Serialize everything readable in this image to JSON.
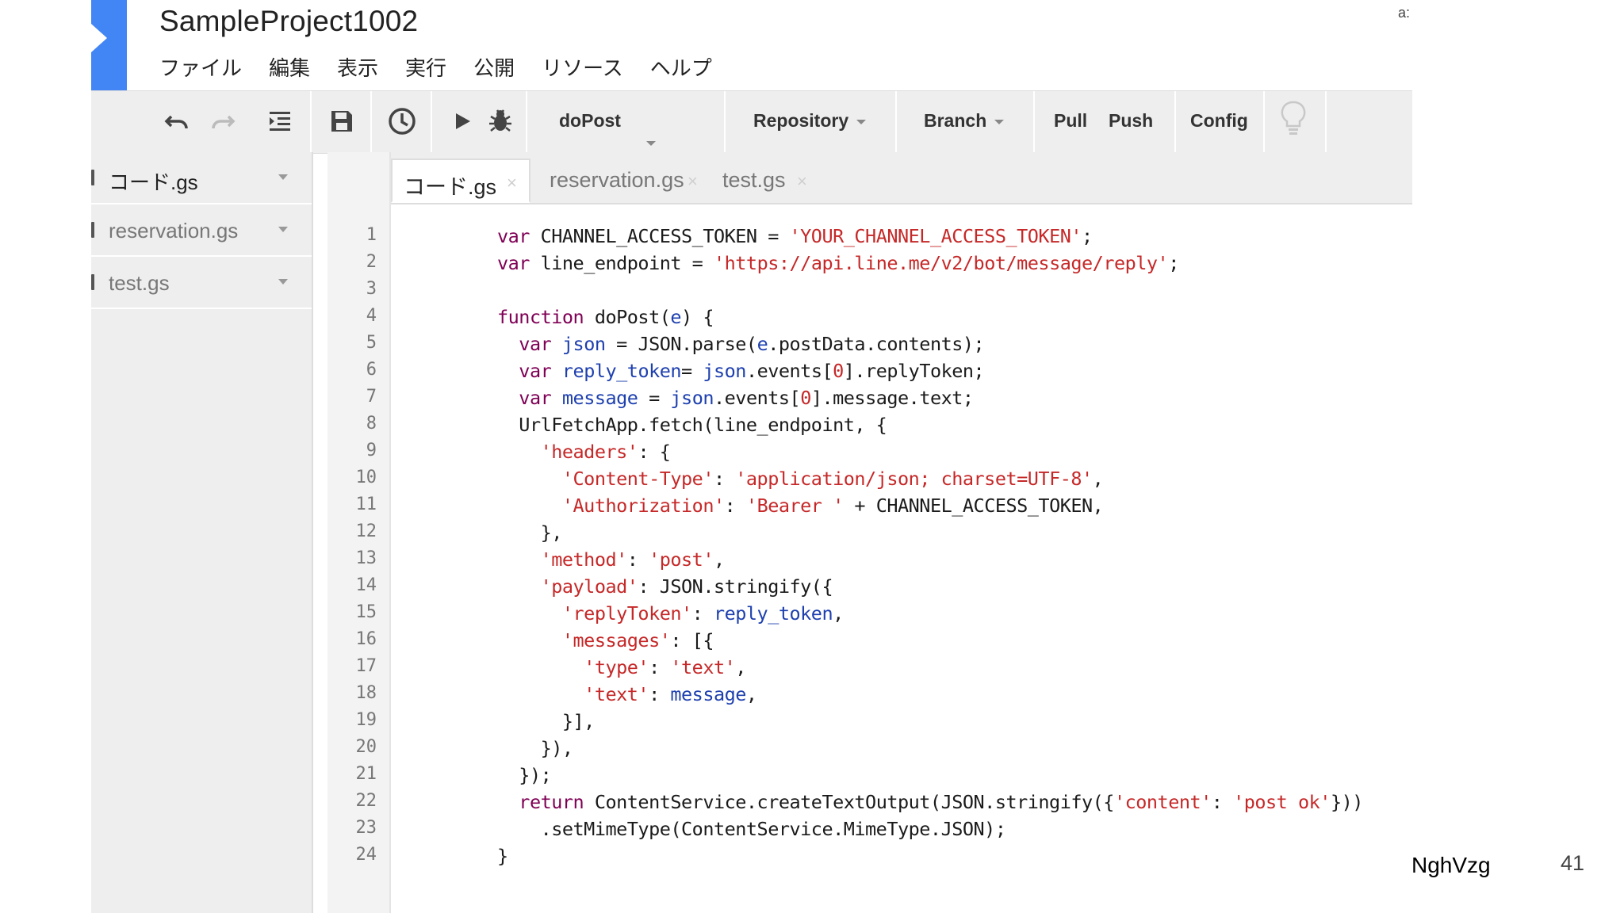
{
  "window": {
    "project_title": "SampleProject1002",
    "user_stub": "a:"
  },
  "menu": [
    {
      "label": "ファイル"
    },
    {
      "label": "編集"
    },
    {
      "label": "表示"
    },
    {
      "label": "実行"
    },
    {
      "label": "公開"
    },
    {
      "label": "リソース"
    },
    {
      "label": "ヘルプ"
    }
  ],
  "toolbar": {
    "undo_icon": "undo-icon",
    "redo_icon": "redo-icon",
    "indent_icon": "indent-icon",
    "save_icon": "save-icon",
    "trigger_icon": "clock-icon",
    "run_icon": "play-icon",
    "debug_icon": "bug-icon",
    "function_select": "doPost",
    "repository_label": "Repository",
    "branch_label": "Branch",
    "pull_label": "Pull",
    "push_label": "Push",
    "config_label": "Config",
    "hint_icon": "lightbulb-icon"
  },
  "files": [
    {
      "name": "コード.gs",
      "active": true
    },
    {
      "name": "reservation.gs",
      "active": false
    },
    {
      "name": "test.gs",
      "active": false
    }
  ],
  "tabs": [
    {
      "label": "コード.gs",
      "close": "×"
    },
    {
      "label": "reservation.gs",
      "close": "×"
    },
    {
      "label": "test.gs",
      "close": "×"
    }
  ],
  "line_numbers": [
    "1",
    "2",
    "3",
    "4",
    "5",
    "6",
    "7",
    "8",
    "9",
    "10",
    "11",
    "12",
    "13",
    "14",
    "15",
    "16",
    "17",
    "18",
    "19",
    "20",
    "21",
    "22",
    "23",
    "24"
  ],
  "code_lines": [
    [
      {
        "t": "k",
        "v": "var"
      },
      {
        "t": "p",
        "v": " CHANNEL_ACCESS_TOKEN = "
      },
      {
        "t": "s",
        "v": "'YOUR_CHANNEL_ACCESS_TOKEN'"
      },
      {
        "t": "p",
        "v": ";"
      }
    ],
    [
      {
        "t": "k",
        "v": "var"
      },
      {
        "t": "p",
        "v": " line_endpoint = "
      },
      {
        "t": "s",
        "v": "'https://api.line.me/v2/bot/message/reply'"
      },
      {
        "t": "p",
        "v": ";"
      }
    ],
    [],
    [
      {
        "t": "k",
        "v": "function"
      },
      {
        "t": "p",
        "v": " doPost("
      },
      {
        "t": "v",
        "v": "e"
      },
      {
        "t": "p",
        "v": ") {"
      }
    ],
    [
      {
        "t": "p",
        "v": "  "
      },
      {
        "t": "k",
        "v": "var"
      },
      {
        "t": "p",
        "v": " "
      },
      {
        "t": "v",
        "v": "json"
      },
      {
        "t": "p",
        "v": " = JSON.parse("
      },
      {
        "t": "v",
        "v": "e"
      },
      {
        "t": "p",
        "v": ".postData.contents);"
      }
    ],
    [
      {
        "t": "p",
        "v": "  "
      },
      {
        "t": "k",
        "v": "var"
      },
      {
        "t": "p",
        "v": " "
      },
      {
        "t": "v",
        "v": "reply_token"
      },
      {
        "t": "p",
        "v": "= "
      },
      {
        "t": "v",
        "v": "json"
      },
      {
        "t": "p",
        "v": ".events["
      },
      {
        "t": "s",
        "v": "0"
      },
      {
        "t": "p",
        "v": "].replyToken;"
      }
    ],
    [
      {
        "t": "p",
        "v": "  "
      },
      {
        "t": "k",
        "v": "var"
      },
      {
        "t": "p",
        "v": " "
      },
      {
        "t": "v",
        "v": "message"
      },
      {
        "t": "p",
        "v": " = "
      },
      {
        "t": "v",
        "v": "json"
      },
      {
        "t": "p",
        "v": ".events["
      },
      {
        "t": "s",
        "v": "0"
      },
      {
        "t": "p",
        "v": "].message.text;"
      }
    ],
    [
      {
        "t": "p",
        "v": "  UrlFetchApp.fetch(line_endpoint, {"
      }
    ],
    [
      {
        "t": "p",
        "v": "    "
      },
      {
        "t": "s",
        "v": "'headers'"
      },
      {
        "t": "p",
        "v": ": {"
      }
    ],
    [
      {
        "t": "p",
        "v": "      "
      },
      {
        "t": "s",
        "v": "'Content-Type'"
      },
      {
        "t": "p",
        "v": ": "
      },
      {
        "t": "s",
        "v": "'application/json; charset=UTF-8'"
      },
      {
        "t": "p",
        "v": ","
      }
    ],
    [
      {
        "t": "p",
        "v": "      "
      },
      {
        "t": "s",
        "v": "'Authorization'"
      },
      {
        "t": "p",
        "v": ": "
      },
      {
        "t": "s",
        "v": "'Bearer '"
      },
      {
        "t": "p",
        "v": " + CHANNEL_ACCESS_TOKEN,"
      }
    ],
    [
      {
        "t": "p",
        "v": "    },"
      }
    ],
    [
      {
        "t": "p",
        "v": "    "
      },
      {
        "t": "s",
        "v": "'method'"
      },
      {
        "t": "p",
        "v": ": "
      },
      {
        "t": "s",
        "v": "'post'"
      },
      {
        "t": "p",
        "v": ","
      }
    ],
    [
      {
        "t": "p",
        "v": "    "
      },
      {
        "t": "s",
        "v": "'payload'"
      },
      {
        "t": "p",
        "v": ": JSON.stringify({"
      }
    ],
    [
      {
        "t": "p",
        "v": "      "
      },
      {
        "t": "s",
        "v": "'replyToken'"
      },
      {
        "t": "p",
        "v": ": "
      },
      {
        "t": "v",
        "v": "reply_token"
      },
      {
        "t": "p",
        "v": ","
      }
    ],
    [
      {
        "t": "p",
        "v": "      "
      },
      {
        "t": "s",
        "v": "'messages'"
      },
      {
        "t": "p",
        "v": ": [{"
      }
    ],
    [
      {
        "t": "p",
        "v": "        "
      },
      {
        "t": "s",
        "v": "'type'"
      },
      {
        "t": "p",
        "v": ": "
      },
      {
        "t": "s",
        "v": "'text'"
      },
      {
        "t": "p",
        "v": ","
      }
    ],
    [
      {
        "t": "p",
        "v": "        "
      },
      {
        "t": "s",
        "v": "'text'"
      },
      {
        "t": "p",
        "v": ": "
      },
      {
        "t": "v",
        "v": "message"
      },
      {
        "t": "p",
        "v": ","
      }
    ],
    [
      {
        "t": "p",
        "v": "      }],"
      }
    ],
    [
      {
        "t": "p",
        "v": "    }),"
      }
    ],
    [
      {
        "t": "p",
        "v": "  });"
      }
    ],
    [
      {
        "t": "p",
        "v": "  "
      },
      {
        "t": "k",
        "v": "return"
      },
      {
        "t": "p",
        "v": " ContentService.createTextOutput(JSON.stringify({"
      },
      {
        "t": "s",
        "v": "'content'"
      },
      {
        "t": "p",
        "v": ": "
      },
      {
        "t": "s",
        "v": "'post ok'"
      },
      {
        "t": "p",
        "v": "}))"
      }
    ],
    [
      {
        "t": "p",
        "v": "    .setMimeType(ContentService.MimeType.JSON);"
      }
    ],
    [
      {
        "t": "p",
        "v": "}"
      }
    ]
  ],
  "footer": {
    "author": "NghVzg",
    "page": "41"
  },
  "colors": {
    "brand_blue": "#4285f4",
    "keyword": "#7f0055",
    "string": "#c62828",
    "variable": "#1e40af",
    "toolbar_bg": "#eeeeee"
  }
}
